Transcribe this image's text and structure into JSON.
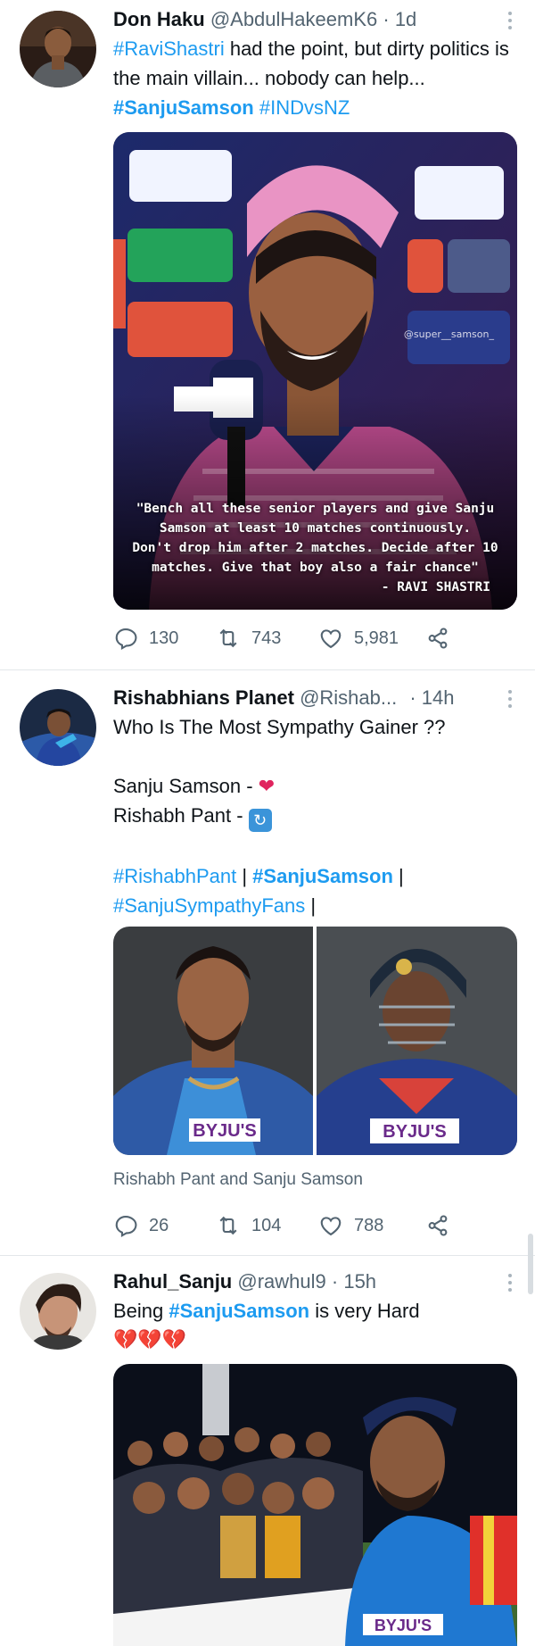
{
  "colors": {
    "link": "#1d9bf0",
    "muted": "#536471",
    "text": "#0f1419",
    "heart": "#e0245e"
  },
  "tweets": [
    {
      "name": "Don Haku",
      "handle": "@AbdulHakeemK6",
      "time": "· 1d",
      "text_parts": [
        "#RaviShastri",
        " had the point, but dirty politics is the main villain... nobody can help... ",
        "#SanjuSamson",
        " ",
        "#INDvsNZ"
      ],
      "media_quote_lines": [
        "\"Bench all these senior players and give Sanju",
        "Samson at least 10 matches continuously.",
        "Don't drop him after 2 matches. Decide after 10",
        "matches. Give that boy also a fair chance\""
      ],
      "media_quote_author": "- RAVI SHASTRI",
      "media_watermark": "@super__samson_",
      "replies": "130",
      "retweets": "743",
      "likes": "5,981"
    },
    {
      "name": "Rishabhians Planet",
      "handle": "@Rishab...",
      "time": "· 14h",
      "line1": "Who Is The Most Sympathy Gainer ??",
      "line2": "Sanju Samson - ",
      "line3": "Rishabh Pant - ",
      "tags": [
        "#RishabhPant",
        " | ",
        "#SanjuSamson",
        " | ",
        "#SanjuSympathyFans",
        " |"
      ],
      "caption": "Rishabh Pant and Sanju Samson",
      "replies": "26",
      "retweets": "104",
      "likes": "788"
    },
    {
      "name": "Rahul_Sanju",
      "handle": "@rawhul9",
      "time": "· 15h",
      "text_parts": [
        "Being ",
        "#SanjuSamson",
        " is very Hard"
      ],
      "emojis": "💔💔💔"
    }
  ],
  "icons": [
    "more-icon",
    "reply-icon",
    "retweet-icon",
    "like-icon",
    "share-icon",
    "red-heart-emoji",
    "repeat-emoji",
    "broken-heart-emoji"
  ]
}
